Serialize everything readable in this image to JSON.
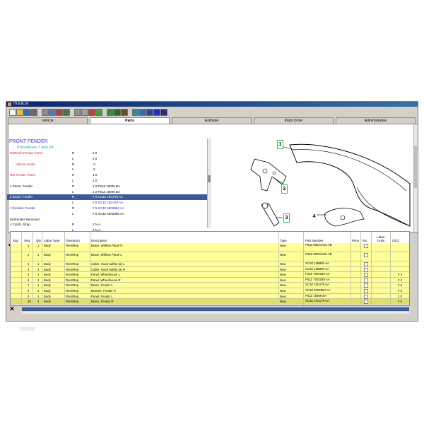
{
  "window": {
    "title": "iTruckList"
  },
  "toolbar": {
    "icons": [
      "new-icon",
      "open-icon",
      "save-icon",
      "print-icon",
      "fax-icon",
      "customer-icon",
      "vehicle-icon",
      "lookup-icon",
      "copy-icon",
      "paste-icon",
      "cut-icon",
      "refresh-icon",
      "import-icon",
      "export-icon",
      "tools-icon",
      "globe-icon",
      "email-icon",
      "report-icon",
      "help-icon",
      "info-icon"
    ]
  },
  "tabs": [
    {
      "label": "Vehicle",
      "active": false
    },
    {
      "label": "Parts",
      "active": true
    },
    {
      "label": "Estimate",
      "active": false
    },
    {
      "label": "Parts Order",
      "active": false
    },
    {
      "label": "Administrative",
      "active": false
    }
  ],
  "parts_panel": {
    "heading": "FRONT FENDER",
    "subheading": "Procedures 7 and 24",
    "rows": [
      {
        "name": "R&Rinsh Fender Panel",
        "side": "R",
        "value": "2.0",
        "style": "red"
      },
      {
        "name": "",
        "side": "L",
        "value": "2.0",
        "style": ""
      },
      {
        "name": "Add for Inside",
        "side": "R",
        "value": ".0",
        "style": "red",
        "indent": true
      },
      {
        "name": "",
        "side": "L",
        "value": ".0",
        "style": ""
      },
      {
        "name": "RSI Fender Panel",
        "side": "R",
        "value": "1.0",
        "style": "red"
      },
      {
        "name": "",
        "side": "L",
        "value": "1.0",
        "style": ""
      },
      {
        "name": "1  Panel, Fender",
        "side": "R",
        "value": "1.0  F81Z 16005 BA",
        "style": ""
      },
      {
        "name": "",
        "side": "L",
        "value": "1.0  F81Z 16006 BA",
        "style": ""
      },
      {
        "name": "2  Brace, Fender",
        "side": "R",
        "value": "# 6  XC3Z 16C078 AA",
        "style": "sel"
      },
      {
        "name": "",
        "side": "L",
        "value": "# 6  XC3Z 16C078 AA",
        "style": "blue"
      },
      {
        "name": "3  Bracket, Fender",
        "side": "R",
        "value": "# 5  XC3Z 6002884 AA",
        "style": "blue"
      },
      {
        "name": "",
        "side": "L",
        "value": "# 5  XC3Z 6002885 AA",
        "style": ""
      },
      {
        "name": "#w/Fender Removed",
        "side": "",
        "value": "",
        "style": ""
      },
      {
        "name": "4  Catch, Strap",
        "side": "R",
        "value": "2  N.A.",
        "style": ""
      },
      {
        "name": "",
        "side": "L",
        "value": "2  N.A.",
        "style": ""
      }
    ]
  },
  "illustration": {
    "callouts": [
      "1",
      "2",
      "3",
      "4"
    ]
  },
  "grid": {
    "headers": {
      "sup": "Sup",
      "seq": "Seq",
      "qty": "Qty",
      "labor_type": "Labor Type",
      "operation": "Operation",
      "description": "Description",
      "type": "Type",
      "part_number": "Part Number",
      "price": "Price",
      "tax": "Tax",
      "labor_units": "Labor Units",
      "ceg": "CEG"
    },
    "rows": [
      {
        "seq": "1",
        "qty": "1",
        "labor": "Body",
        "op": "Rem/Rep",
        "desc": "Brace, Whlhse Panel R",
        "type": "New",
        "pn": "F81Z 60024A40 AB",
        "ceg": "",
        "tall": true
      },
      {
        "seq": "2",
        "qty": "1",
        "labor": "Body",
        "op": "Rem/Rep",
        "desc": "Brace, Whlhse Panel L",
        "type": "New",
        "pn": "F81Z 60024A40 AB",
        "ceg": "",
        "tall": true
      },
      {
        "seq": "3",
        "qty": "1",
        "labor": "Body",
        "op": "Rem/Rep",
        "desc": "Cable, Hood Safety (a) L",
        "type": "New",
        "pn": "XC4Z 16B890 AA",
        "ceg": ""
      },
      {
        "seq": "4",
        "qty": "1",
        "labor": "Body",
        "op": "Rem/Rep",
        "desc": "Cable, Hood Safety (a) R",
        "type": "New",
        "pn": "XC4Z 16B890 AA",
        "ceg": ""
      },
      {
        "seq": "5",
        "qty": "1",
        "labor": "Body",
        "op": "Rem/Rep",
        "desc": "Panel, Wheelhouse L",
        "type": "New",
        "pn": "F81Z 7002049 AA",
        "ceg": "# 3"
      },
      {
        "seq": "6",
        "qty": "1",
        "labor": "Body",
        "op": "Rem/Rep",
        "desc": "Panel, Wheelhouse R",
        "type": "New",
        "pn": "F81Z 7002048 AA",
        "ceg": "# 3"
      },
      {
        "seq": "7",
        "qty": "1",
        "labor": "Body",
        "op": "Rem/Rep",
        "desc": "Brace, Fender L",
        "type": "New",
        "pn": "XC3Z 16C078 AA",
        "ceg": "# 6"
      },
      {
        "seq": "8",
        "qty": "1",
        "labor": "Body",
        "op": "Rem/Rep",
        "desc": "Bracket, Fender R",
        "type": "New",
        "pn": "XC3Z 6002884 AA",
        "ceg": "# 5"
      },
      {
        "seq": "9",
        "qty": "1",
        "labor": "Body",
        "op": "Rem/Rep",
        "desc": "Panel, Fender L",
        "type": "New",
        "pn": "F81Z 16006 BA",
        "ceg": "1.0"
      },
      {
        "seq": "10",
        "qty": "1",
        "labor": "Body",
        "op": "Rem/Rep",
        "desc": "Brace, Fender R",
        "type": "New",
        "pn": "XC3Z 16C078 AA",
        "ceg": "# 6",
        "sel": true
      }
    ]
  },
  "sidebar_tools": [
    {
      "name": "car-icon",
      "glyph": "▬"
    },
    {
      "name": "add-icon",
      "glyph": "+"
    },
    {
      "name": "edit-icon",
      "glyph": "✎"
    },
    {
      "name": "add-multiple-icon",
      "glyph": "⁑"
    },
    {
      "name": "search-icon",
      "glyph": "⚲"
    },
    {
      "name": "remove-icon",
      "glyph": "−"
    },
    {
      "name": "delete-icon",
      "glyph": "✕"
    }
  ],
  "colors": {
    "selection": "#3a5a9a",
    "grid_row": "#ffff99",
    "callout_border": "#2ecc40"
  }
}
